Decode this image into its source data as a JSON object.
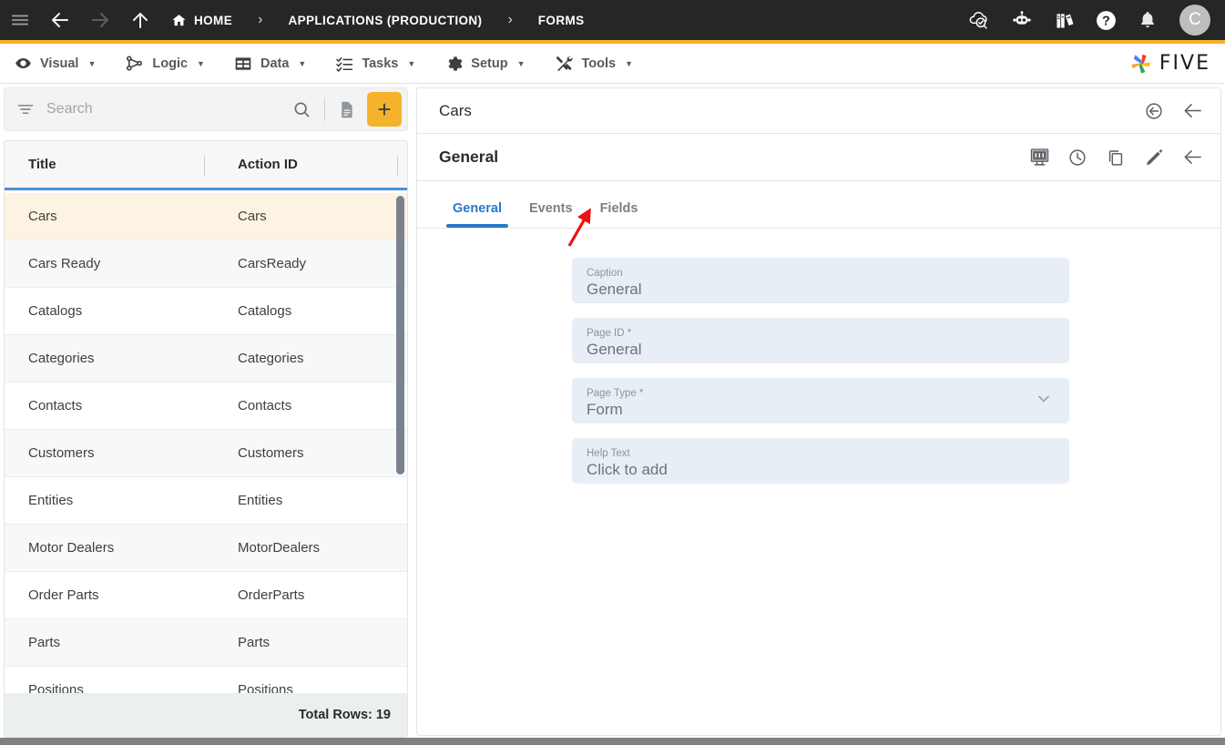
{
  "topbar": {
    "icons": [
      {
        "name": "hamburger-menu-icon",
        "label": "Menu"
      },
      {
        "name": "back-arrow-icon",
        "label": "Back"
      },
      {
        "name": "forward-arrow-icon",
        "label": "Forward"
      },
      {
        "name": "up-arrow-icon",
        "label": "Up"
      }
    ],
    "breadcrumbs": [
      {
        "label": "HOME",
        "icon": "home-icon"
      },
      {
        "label": "APPLICATIONS (PRODUCTION)",
        "icon": ""
      },
      {
        "label": "FORMS",
        "icon": ""
      }
    ],
    "separator": "›",
    "right_icons": [
      {
        "name": "cloud-check-icon",
        "label": "Deploy"
      },
      {
        "name": "robot-icon",
        "label": "Assistant"
      },
      {
        "name": "books-icon",
        "label": "Documentation"
      },
      {
        "name": "help-icon",
        "label": "Help"
      },
      {
        "name": "bell-icon",
        "label": "Notifications"
      }
    ],
    "avatar_initial": "C",
    "accent_color": "#f5b32b",
    "bar_color": "#262626"
  },
  "menubar": {
    "items": [
      {
        "label": "Visual",
        "icon": "eye-icon"
      },
      {
        "label": "Logic",
        "icon": "flow-nodes-icon"
      },
      {
        "label": "Data",
        "icon": "table-icon"
      },
      {
        "label": "Tasks",
        "icon": "checklist-icon"
      },
      {
        "label": "Setup",
        "icon": "gear-icon"
      },
      {
        "label": "Tools",
        "icon": "tools-icon"
      }
    ],
    "caret": "▼",
    "logo_text": "FIVE"
  },
  "sidebar": {
    "search": {
      "value": "",
      "placeholder": "Search"
    },
    "add_button_label": "+",
    "columns": [
      "Title",
      "Action ID"
    ],
    "rows": [
      {
        "title": "Cars",
        "action_id": "Cars",
        "selected": true
      },
      {
        "title": "Cars Ready",
        "action_id": "CarsReady",
        "selected": false
      },
      {
        "title": "Catalogs",
        "action_id": "Catalogs",
        "selected": false
      },
      {
        "title": "Categories",
        "action_id": "Categories",
        "selected": false
      },
      {
        "title": "Contacts",
        "action_id": "Contacts",
        "selected": false
      },
      {
        "title": "Customers",
        "action_id": "Customers",
        "selected": false
      },
      {
        "title": "Entities",
        "action_id": "Entities",
        "selected": false
      },
      {
        "title": "Motor Dealers",
        "action_id": "MotorDealers",
        "selected": false
      },
      {
        "title": "Order Parts",
        "action_id": "OrderParts",
        "selected": false
      },
      {
        "title": "Parts",
        "action_id": "Parts",
        "selected": false
      },
      {
        "title": "Positions",
        "action_id": "Positions",
        "selected": false
      }
    ],
    "footer": "Total Rows: 19",
    "selected_row_color": "#fdf3e3",
    "header_underline_color": "#4a90d9"
  },
  "detail": {
    "record_header": {
      "title": "Cars",
      "icons": [
        {
          "name": "revert-circle-icon",
          "label": "Revert"
        },
        {
          "name": "back-arrow-icon",
          "label": "Back"
        }
      ]
    },
    "page_header": {
      "title": "General",
      "icons": [
        {
          "name": "form-preview-icon",
          "label": "Preview"
        },
        {
          "name": "clock-icon",
          "label": "History"
        },
        {
          "name": "copy-icon",
          "label": "Duplicate"
        },
        {
          "name": "pencil-icon",
          "label": "Edit"
        },
        {
          "name": "back-arrow-icon",
          "label": "Back"
        }
      ]
    },
    "tabs": [
      {
        "label": "General",
        "active": true
      },
      {
        "label": "Events",
        "active": false
      },
      {
        "label": "Fields",
        "active": false
      }
    ],
    "active_tab_color": "#2a78c9",
    "fields": [
      {
        "label": "Caption",
        "value": "General",
        "type": "text"
      },
      {
        "label": "Page ID *",
        "value": "General",
        "type": "text"
      },
      {
        "label": "Page Type *",
        "value": "Form",
        "type": "select"
      },
      {
        "label": "Help Text",
        "value": "Click to add",
        "type": "text"
      }
    ]
  },
  "annotation": {
    "name": "red-arrow-pointing-to-fields-tab",
    "color": "#ee1111",
    "target": "Fields"
  }
}
